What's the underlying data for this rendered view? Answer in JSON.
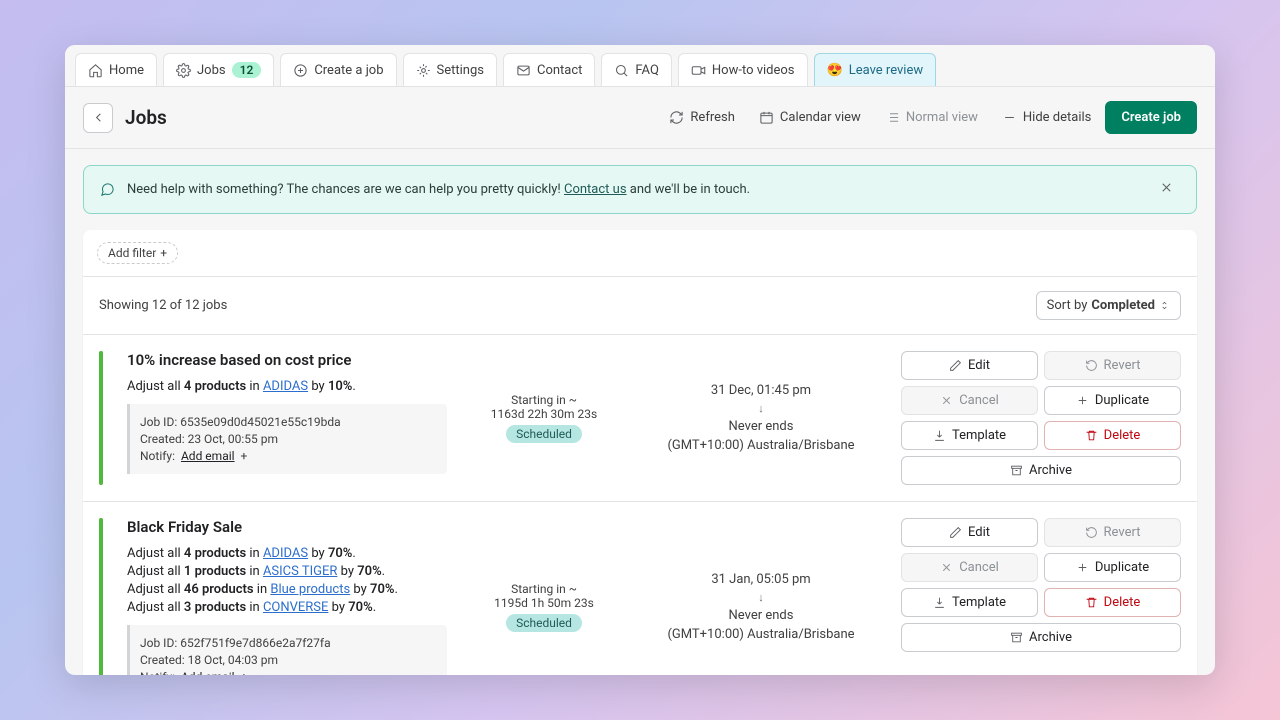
{
  "nav": {
    "home": "Home",
    "jobs": "Jobs",
    "jobs_badge": "12",
    "create": "Create a job",
    "settings": "Settings",
    "contact": "Contact",
    "faq": "FAQ",
    "videos": "How-to videos",
    "review": "Leave review"
  },
  "header": {
    "title": "Jobs",
    "refresh": "Refresh",
    "calendar": "Calendar view",
    "normal": "Normal view",
    "hide": "Hide details",
    "create": "Create job"
  },
  "banner": {
    "prefix": "Need help with something? The chances are we can help you pretty quickly! ",
    "link": "Contact us",
    "suffix": " and we'll be in touch."
  },
  "filter_label": "Add filter",
  "showing": "Showing 12 of 12 jobs",
  "sort": {
    "prefix": "Sort by ",
    "value": "Completed"
  },
  "actions": {
    "edit": "Edit",
    "revert": "Revert",
    "cancel": "Cancel",
    "duplicate": "Duplicate",
    "template": "Template",
    "delete": "Delete",
    "archive": "Archive"
  },
  "jobs": [
    {
      "title": "10% increase based on cost price",
      "rules": [
        {
          "pre": "Adjust all ",
          "count": "4 products",
          "mid": " in ",
          "link": "ADIDAS",
          "post": " by ",
          "amt": "10%",
          "end": "."
        }
      ],
      "job_id": "Job ID: 6535e09d0d45021e55c19bda",
      "created": "Created: 23 Oct, 00:55 pm",
      "notify_label": "Notify:",
      "add_email": "Add email",
      "starting": "Starting in ~",
      "countdown": "1163d 22h 30m 23s",
      "status": "Scheduled",
      "date": "31 Dec, 01:45 pm",
      "ends": "Never ends",
      "tz": "(GMT+10:00) Australia/Brisbane"
    },
    {
      "title": "Black Friday Sale",
      "rules": [
        {
          "pre": "Adjust all ",
          "count": "4 products",
          "mid": " in ",
          "link": "ADIDAS",
          "post": " by ",
          "amt": "70%",
          "end": "."
        },
        {
          "pre": "Adjust all ",
          "count": "1 products",
          "mid": " in ",
          "link": "ASICS TIGER",
          "post": " by ",
          "amt": "70%",
          "end": "."
        },
        {
          "pre": "Adjust all ",
          "count": "46 products",
          "mid": " in ",
          "link": "Blue products",
          "post": " by ",
          "amt": "70%",
          "end": "."
        },
        {
          "pre": "Adjust all ",
          "count": "3 products",
          "mid": " in ",
          "link": "CONVERSE",
          "post": " by ",
          "amt": "70%",
          "end": "."
        }
      ],
      "job_id": "Job ID: 652f751f9e7d866e2a7f27fa",
      "created": "Created: 18 Oct, 04:03 pm",
      "notify_label": "Notify:",
      "add_email": "Add email",
      "starting": "Starting in ~",
      "countdown": "1195d 1h 50m 23s",
      "status": "Scheduled",
      "date": "31 Jan, 05:05 pm",
      "ends": "Never ends",
      "tz": "(GMT+10:00) Australia/Brisbane"
    }
  ]
}
